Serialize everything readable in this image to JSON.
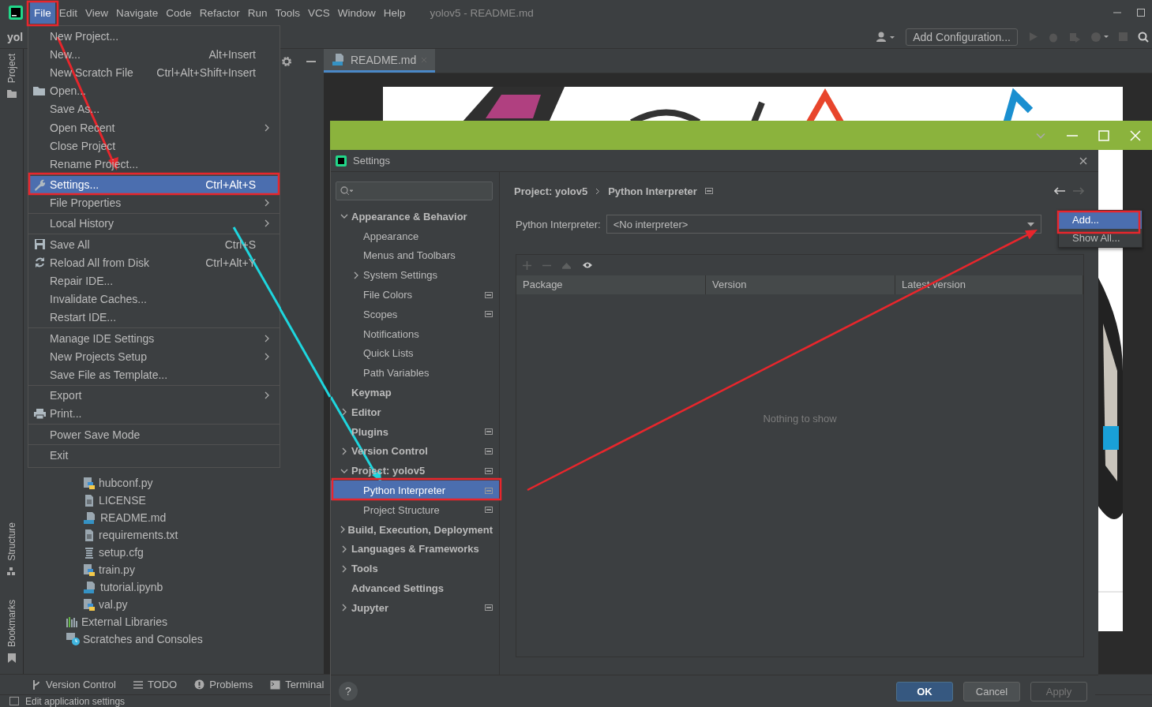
{
  "menubar": {
    "items": [
      {
        "label": "File",
        "selected": true
      },
      {
        "label": "Edit",
        "selected": false
      },
      {
        "label": "View",
        "selected": false
      },
      {
        "label": "Navigate",
        "selected": false
      },
      {
        "label": "Code",
        "selected": false
      },
      {
        "label": "Refactor",
        "selected": false
      },
      {
        "label": "Run",
        "selected": false
      },
      {
        "label": "Tools",
        "selected": false
      },
      {
        "label": "VCS",
        "selected": false
      },
      {
        "label": "Window",
        "selected": false
      },
      {
        "label": "Help",
        "selected": false
      }
    ],
    "title": "yolov5 - README.md"
  },
  "toolbar": {
    "project": "yol",
    "run_config": "Add Configuration..."
  },
  "side_stripe": {
    "top": [
      "Project"
    ],
    "bottom": [
      "Structure",
      "Bookmarks"
    ]
  },
  "project_tree": [
    {
      "label": "hubconf.py",
      "kind": "python"
    },
    {
      "label": "LICENSE",
      "kind": "text"
    },
    {
      "label": "README.md",
      "kind": "markdown"
    },
    {
      "label": "requirements.txt",
      "kind": "text"
    },
    {
      "label": "setup.cfg",
      "kind": "config"
    },
    {
      "label": "train.py",
      "kind": "python"
    },
    {
      "label": "tutorial.ipynb",
      "kind": "notebook"
    },
    {
      "label": "val.py",
      "kind": "python"
    },
    {
      "label": "External Libraries",
      "kind": "libraries"
    },
    {
      "label": "Scratches and Consoles",
      "kind": "scratches"
    }
  ],
  "editor_tabs": [
    {
      "label": "README.md",
      "selected": true
    }
  ],
  "tool_windows": [
    {
      "label": "Version Control",
      "kind": "vcs"
    },
    {
      "label": "TODO",
      "kind": "todo"
    },
    {
      "label": "Problems",
      "kind": "problems"
    },
    {
      "label": "Terminal",
      "kind": "terminal"
    }
  ],
  "status_bar": "Edit application settings",
  "file_menu": [
    {
      "kind": "item",
      "label": "New Project...",
      "submenu": false,
      "selected": false
    },
    {
      "kind": "item",
      "label": "New...",
      "shortcut": "Alt+Insert",
      "submenu": false,
      "selected": false
    },
    {
      "kind": "item",
      "label": "New Scratch File",
      "shortcut": "Ctrl+Alt+Shift+Insert",
      "submenu": false,
      "selected": false
    },
    {
      "kind": "open",
      "label": "Open...",
      "submenu": false,
      "selected": false
    },
    {
      "kind": "item",
      "label": "Save As...",
      "submenu": false,
      "selected": false
    },
    {
      "kind": "item",
      "label": "Open Recent",
      "submenu": true,
      "selected": false
    },
    {
      "kind": "item",
      "label": "Close Project",
      "submenu": false,
      "selected": false
    },
    {
      "kind": "item",
      "label": "Rename Project...",
      "submenu": false,
      "selected": false
    },
    {
      "kind": "separator"
    },
    {
      "kind": "settings",
      "label": "Settings...",
      "shortcut": "Ctrl+Alt+S",
      "submenu": false,
      "selected": true
    },
    {
      "kind": "item",
      "label": "File Properties",
      "submenu": true,
      "selected": false
    },
    {
      "kind": "separator"
    },
    {
      "kind": "item",
      "label": "Local History",
      "submenu": true,
      "selected": false
    },
    {
      "kind": "separator"
    },
    {
      "kind": "save",
      "label": "Save All",
      "shortcut": "Ctrl+S",
      "submenu": false,
      "selected": false
    },
    {
      "kind": "reload",
      "label": "Reload All from Disk",
      "shortcut": "Ctrl+Alt+Y",
      "submenu": false,
      "selected": false
    },
    {
      "kind": "item",
      "label": "Repair IDE...",
      "submenu": false,
      "selected": false
    },
    {
      "kind": "item",
      "label": "Invalidate Caches...",
      "submenu": false,
      "selected": false
    },
    {
      "kind": "item",
      "label": "Restart IDE...",
      "submenu": false,
      "selected": false
    },
    {
      "kind": "separator"
    },
    {
      "kind": "item",
      "label": "Manage IDE Settings",
      "submenu": true,
      "selected": false
    },
    {
      "kind": "item",
      "label": "New Projects Setup",
      "submenu": true,
      "selected": false
    },
    {
      "kind": "item",
      "label": "Save File as Template...",
      "submenu": false,
      "selected": false
    },
    {
      "kind": "separator"
    },
    {
      "kind": "item",
      "label": "Export",
      "submenu": true,
      "selected": false
    },
    {
      "kind": "print",
      "label": "Print...",
      "submenu": false,
      "selected": false
    },
    {
      "kind": "separator"
    },
    {
      "kind": "item",
      "label": "Power Save Mode",
      "submenu": false,
      "selected": false
    },
    {
      "kind": "separator"
    },
    {
      "kind": "item",
      "label": "Exit",
      "submenu": false,
      "selected": false
    }
  ],
  "settings": {
    "title": "Settings",
    "tree": [
      {
        "label": "Appearance & Behavior",
        "bold": true,
        "expanded": true,
        "selected": false,
        "project_scope": false,
        "children": [
          {
            "label": "Appearance",
            "bold": false,
            "selected": false,
            "project_scope": false
          },
          {
            "label": "Menus and Toolbars",
            "bold": false,
            "selected": false,
            "project_scope": false
          },
          {
            "label": "System Settings",
            "bold": false,
            "expanded": false,
            "selected": false,
            "project_scope": false
          },
          {
            "label": "File Colors",
            "bold": false,
            "selected": false,
            "project_scope": true
          },
          {
            "label": "Scopes",
            "bold": false,
            "selected": false,
            "project_scope": true
          },
          {
            "label": "Notifications",
            "bold": false,
            "selected": false,
            "project_scope": false
          },
          {
            "label": "Quick Lists",
            "bold": false,
            "selected": false,
            "project_scope": false
          },
          {
            "label": "Path Variables",
            "bold": false,
            "selected": false,
            "project_scope": false
          }
        ]
      },
      {
        "label": "Keymap",
        "bold": true,
        "selected": false,
        "project_scope": false
      },
      {
        "label": "Editor",
        "bold": true,
        "expanded": false,
        "selected": false,
        "project_scope": false
      },
      {
        "label": "Plugins",
        "bold": true,
        "selected": false,
        "project_scope": true
      },
      {
        "label": "Version Control",
        "bold": true,
        "expanded": false,
        "selected": false,
        "project_scope": true
      },
      {
        "label": "Project: yolov5",
        "bold": true,
        "expanded": true,
        "selected": false,
        "project_scope": true,
        "children": [
          {
            "label": "Python Interpreter",
            "bold": false,
            "selected": true,
            "project_scope": true
          },
          {
            "label": "Project Structure",
            "bold": false,
            "selected": false,
            "project_scope": true
          }
        ]
      },
      {
        "label": "Build, Execution, Deployment",
        "bold": true,
        "expanded": false,
        "selected": false,
        "project_scope": false
      },
      {
        "label": "Languages & Frameworks",
        "bold": true,
        "expanded": false,
        "selected": false,
        "project_scope": false
      },
      {
        "label": "Tools",
        "bold": true,
        "expanded": false,
        "selected": false,
        "project_scope": false
      },
      {
        "label": "Advanced Settings",
        "bold": true,
        "selected": false,
        "project_scope": false
      },
      {
        "label": "Jupyter",
        "bold": true,
        "expanded": false,
        "selected": false,
        "project_scope": true
      }
    ],
    "breadcrumb": [
      "Project: yolov5",
      "Python Interpreter"
    ],
    "interpreter_label": "Python Interpreter:",
    "interpreter_value": "<No interpreter>",
    "popup": [
      {
        "label": "Add...",
        "selected": true
      },
      {
        "label": "Show All...",
        "selected": false
      }
    ],
    "columns": [
      "Package",
      "Version",
      "Latest version"
    ],
    "empty_text": "Nothing to show",
    "help": "?",
    "buttons": [
      {
        "label": "OK",
        "kind": "default",
        "disabled": false
      },
      {
        "label": "Cancel",
        "kind": "normal",
        "disabled": false
      },
      {
        "label": "Apply",
        "kind": "normal",
        "disabled": true
      }
    ]
  }
}
